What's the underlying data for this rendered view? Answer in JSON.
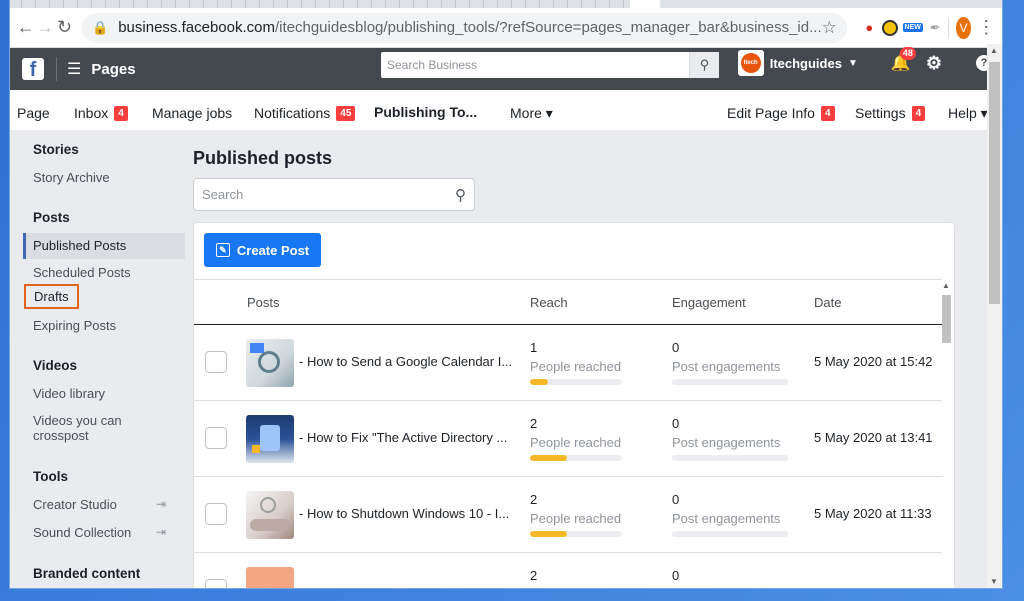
{
  "browser": {
    "url_host": "business.facebook.com",
    "url_path": "/itechguidesblog/publishing_tools/?refSource=pages_manager_bar&business_id..."
  },
  "topbar": {
    "section_label": "Pages",
    "search_placeholder": "Search Business",
    "page_name": "Itechguides",
    "notifications_count": "48"
  },
  "pagenav": {
    "items": [
      {
        "label": "Page",
        "badge": ""
      },
      {
        "label": "Inbox",
        "badge": "4"
      },
      {
        "label": "Manage jobs",
        "badge": ""
      },
      {
        "label": "Notifications",
        "badge": "45"
      },
      {
        "label": "Publishing To...",
        "badge": ""
      },
      {
        "label": "More ▾",
        "badge": ""
      },
      {
        "label": "Edit Page Info",
        "badge": "4"
      },
      {
        "label": "Settings",
        "badge": "4"
      },
      {
        "label": "Help ▾",
        "badge": ""
      }
    ]
  },
  "sidebar": {
    "stories": "Stories",
    "story_archive": "Story Archive",
    "posts": "Posts",
    "published_posts": "Published Posts",
    "scheduled_posts": "Scheduled Posts",
    "drafts": "Drafts",
    "expiring_posts": "Expiring Posts",
    "videos": "Videos",
    "video_library": "Video library",
    "videos_crosspost_1": "Videos you can",
    "videos_crosspost_2": "crosspost",
    "tools": "Tools",
    "creator_studio": "Creator Studio",
    "sound_collection": "Sound Collection",
    "branded_content": "Branded content"
  },
  "main": {
    "title": "Published posts",
    "search_placeholder": "Search",
    "create_post": "Create Post",
    "columns": {
      "posts": "Posts",
      "reach": "Reach",
      "engagement": "Engagement",
      "date": "Date"
    },
    "rows": [
      {
        "title": "- How to Send a Google Calendar I...",
        "reach": "1",
        "reach_label": "People reached",
        "reach_fill": 0.2,
        "engagement": "0",
        "engagement_label": "Post engagements",
        "date": "5 May 2020 at 15:42"
      },
      {
        "title": "- How to Fix \"The Active Directory ...",
        "reach": "2",
        "reach_label": "People reached",
        "reach_fill": 0.4,
        "engagement": "0",
        "engagement_label": "Post engagements",
        "date": "5 May 2020 at 13:41"
      },
      {
        "title": "- How to Shutdown Windows 10 - I...",
        "reach": "2",
        "reach_label": "People reached",
        "reach_fill": 0.4,
        "engagement": "0",
        "engagement_label": "Post engagements",
        "date": "5 May 2020 at 11:33"
      },
      {
        "title": "",
        "reach": "2",
        "reach_label": "",
        "reach_fill": 0,
        "engagement": "0",
        "engagement_label": "",
        "date": ""
      }
    ]
  }
}
